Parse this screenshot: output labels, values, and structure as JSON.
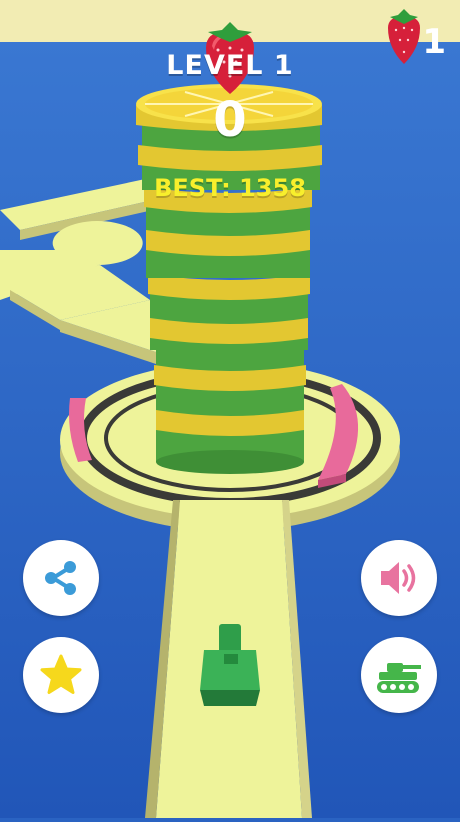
{
  "hud": {
    "level_label": "LEVEL 1",
    "score": "0",
    "best_label": "BEST: 1358",
    "fruit_count": "1"
  },
  "icons": {
    "fruit": "strawberry-icon",
    "share": "share-icon",
    "star": "star-icon",
    "sound": "speaker-icon",
    "tank": "tank-icon"
  },
  "colors": {
    "water": "#2a63c2",
    "platform": "#eef39a",
    "tower_yellow": "#e3c731",
    "tower_green": "#4da540",
    "rail_pink": "#e86a9b",
    "player_tank": "#2f9e4a",
    "best_text": "#f8ef2c",
    "share_blue": "#3b9bd8",
    "star_yellow": "#f6d81c",
    "sound_pink": "#e8739f",
    "tank_green": "#45b64a"
  }
}
